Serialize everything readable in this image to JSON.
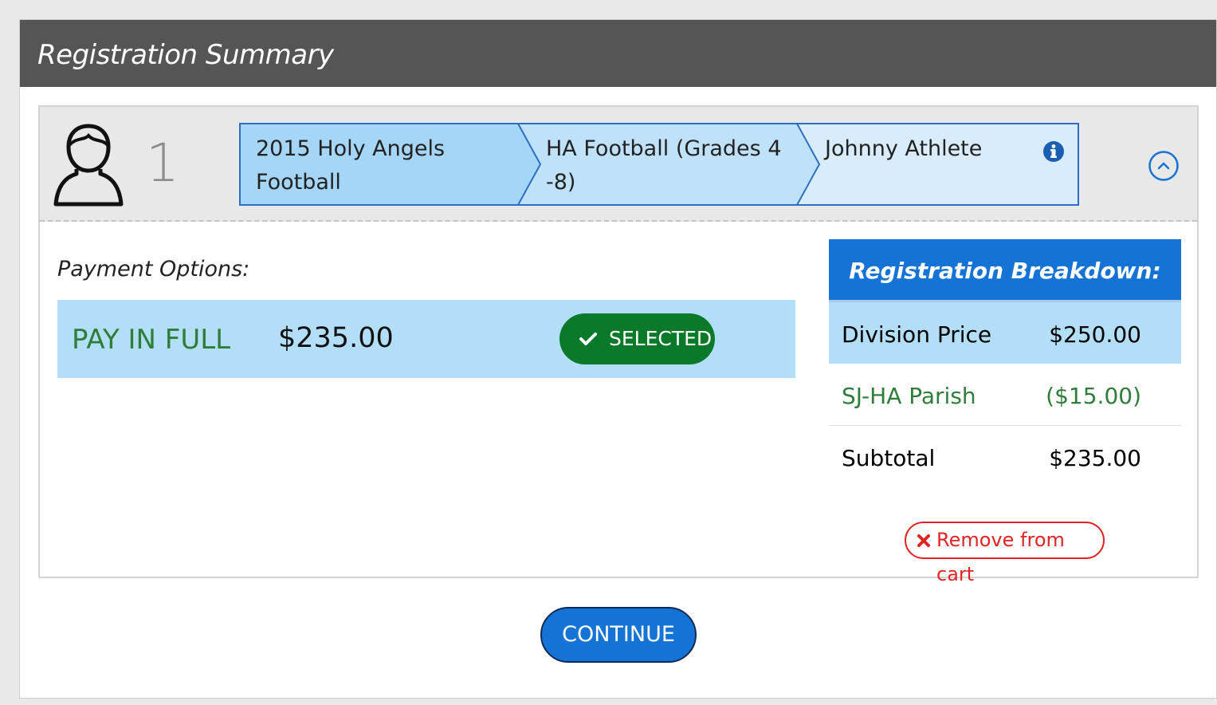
{
  "header": {
    "title": "Registration Summary"
  },
  "registration": {
    "number": "1",
    "breadcrumb": [
      {
        "line1": "2015 Holy Angels",
        "line2": "Football"
      },
      {
        "line1": "HA Football (Grades 4",
        "line2": "-8)"
      },
      {
        "line1": "Johnny Athlete",
        "line2": ""
      }
    ],
    "icons": {
      "person": "person-icon",
      "info": "info-icon",
      "collapse": "chevron-up-circle-icon"
    }
  },
  "payment": {
    "label": "Payment Options:",
    "option": {
      "name": "PAY IN FULL",
      "amount": "$235.00",
      "status": "SELECTED"
    }
  },
  "breakdown": {
    "title": "Registration Breakdown:",
    "rows": [
      {
        "label": "Division Price",
        "value": "$250.00"
      },
      {
        "label": "SJ-HA Parish",
        "value": "($15.00)"
      },
      {
        "label": "Subtotal",
        "value": "$235.00"
      }
    ]
  },
  "actions": {
    "remove": "Remove from cart",
    "continue": "CONTINUE"
  },
  "colors": {
    "header_bg": "#555555",
    "accent_blue": "#1673d6",
    "light_blue": "#b3def8",
    "success_green": "#0a7a2a",
    "discount_green": "#2f7d3a",
    "danger_red": "#e02424"
  }
}
